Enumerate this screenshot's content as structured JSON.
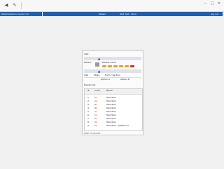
{
  "toolbar": {
    "back_icon": "back-arrow-icon",
    "forward_icon": "forward-arrow-icon",
    "edit_icon": "pencil-icon",
    "window_controls": [
      "─",
      "□",
      "✕"
    ]
  },
  "titlebar": {
    "left_text": "DataCollection Center 1.0",
    "center_text": "Patient",
    "center_text2": "Test Visit - Clinic",
    "right_text": "Log out"
  },
  "panel": {
    "heading": "Visit",
    "patient_label": "Patient:",
    "patient_name": "Patient name",
    "visit_label": "Visit",
    "steps_label": "Steps",
    "section_label": "Form / Section",
    "radio_a": "Option A",
    "radio_b": "Option B",
    "list_title": "Results list",
    "columns": [
      "#",
      "Code",
      "Name"
    ],
    "rows": [
      {
        "id": "1",
        "code": "A1",
        "name": "Test item"
      },
      {
        "id": "2",
        "code": "A2",
        "name": "Test item"
      },
      {
        "id": "3",
        "code": "B1",
        "name": "Test item"
      },
      {
        "id": "4",
        "code": "B2",
        "name": "Test item"
      },
      {
        "id": "5",
        "code": "C1",
        "name": "Test item"
      },
      {
        "id": "6",
        "code": "C2",
        "name": "Test item"
      },
      {
        "id": "7",
        "code": "D1",
        "name": "Test item"
      },
      {
        "id": "8",
        "code": "D2",
        "name": "Test item"
      },
      {
        "id": "9",
        "code": "E1",
        "name": "Test item - additional"
      }
    ],
    "footer": "Total: 9 records"
  },
  "colors": {
    "brand_blue": "#1f5fae",
    "accent_red": "#c33"
  }
}
